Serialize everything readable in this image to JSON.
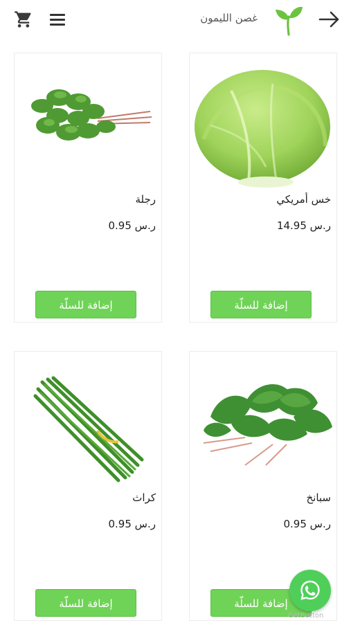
{
  "header": {
    "brand_name": "غصن الليمون",
    "cart_icon": "cart-icon",
    "menu_icon": "hamburger-menu-icon",
    "back_icon": "arrow-right-icon",
    "logo_color": "#6cc33f"
  },
  "products": [
    {
      "name": "خس أمريكي",
      "price": "ر.س 14.95",
      "button": "إضافة للسلّة",
      "image": "iceberg-lettuce"
    },
    {
      "name": "رجلة",
      "price": "ر.س 0.95",
      "button": "إضافة للسلّة",
      "image": "purslane"
    },
    {
      "name": "سبانخ",
      "price": "ر.س 0.95",
      "button": "إضافة للسلّة",
      "image": "spinach"
    },
    {
      "name": "كراث",
      "price": "ر.س 0.95",
      "button": "إضافة للسلّة",
      "image": "leek"
    }
  ],
  "whatsapp": {
    "icon": "whatsapp-icon",
    "badge_text": "GetButton",
    "color": "#4fcf5a"
  },
  "colors": {
    "accent": "#6fd357",
    "text": "#1f1f1f",
    "border": "#ececec"
  }
}
